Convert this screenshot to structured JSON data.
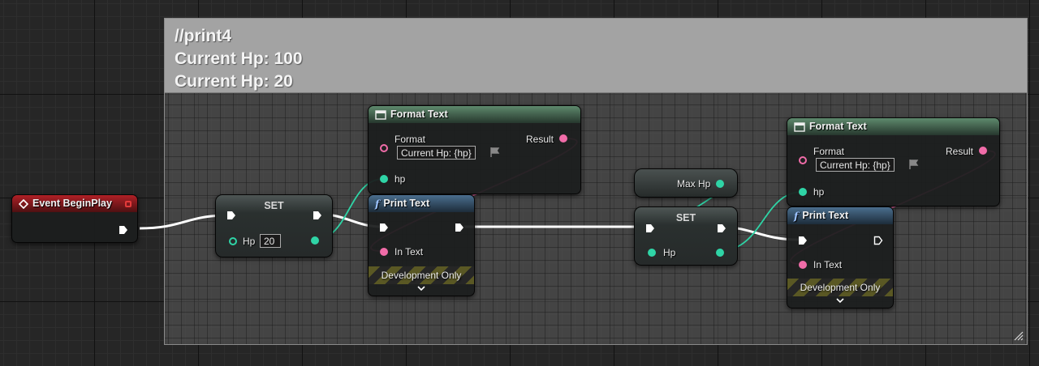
{
  "comment": {
    "lines": [
      "//print4",
      "Current Hp: 100",
      "Current Hp: 20"
    ]
  },
  "event_node": {
    "title": "Event BeginPlay"
  },
  "set_node_1": {
    "title": "SET",
    "pin_label": "Hp",
    "value": "20"
  },
  "format_text_1": {
    "title": "Format Text",
    "format_label": "Format",
    "format_value": "Current Hp: {hp}",
    "result_label": "Result",
    "hp_label": "hp"
  },
  "print_text_1": {
    "title": "Print Text",
    "in_text_label": "In Text",
    "dev_label": "Development Only"
  },
  "get_max_hp": {
    "label": "Max Hp"
  },
  "set_node_2": {
    "title": "SET",
    "pin_label": "Hp"
  },
  "format_text_2": {
    "title": "Format Text",
    "format_label": "Format",
    "format_value": "Current Hp: {hp}",
    "result_label": "Result",
    "hp_label": "hp"
  },
  "print_text_2": {
    "title": "Print Text",
    "in_text_label": "In Text",
    "dev_label": "Development Only"
  },
  "colors": {
    "exec_wire": "#ffffff",
    "int_pin": "#2fd4a6",
    "text_pin": "#f06ca8",
    "event_header": "#b02026",
    "format_header": "#5e8a6d",
    "print_header": "#4a6e8e"
  },
  "icons": [
    "event-diamond-icon",
    "pure-function-icon",
    "function-icon",
    "flag-icon",
    "chevron-down-icon",
    "resize-grip-icon",
    "delegate-square-icon"
  ]
}
